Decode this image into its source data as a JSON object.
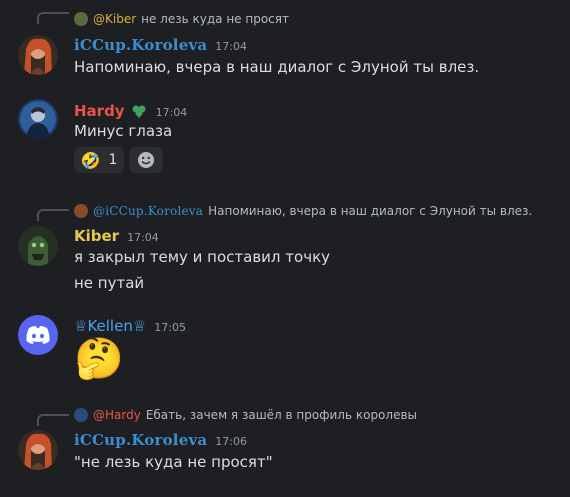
{
  "messages": [
    {
      "reply": {
        "author": "@Kiber",
        "text": "не лезь куда не просят",
        "author_color": "#d4b13a"
      },
      "author": "iCCup.Koroleva",
      "author_color": "#3b8fd0",
      "time": "17:04",
      "lines": [
        "Напоминаю, вчера в наш диалог с Элуной ты влез."
      ]
    },
    {
      "author": "Hardy",
      "author_color": "#e8544b",
      "badge": "clover-icon",
      "time": "17:04",
      "lines": [
        "Минус глаза"
      ],
      "reaction": {
        "emoji": "🤣",
        "count": "1"
      }
    },
    {
      "reply": {
        "author": "@iCCup.Koroleva",
        "text": "Напоминаю, вчера в наш диалог с Элуной ты влез.",
        "author_color": "#3b8fd0"
      },
      "author": "Kiber",
      "author_color": "#e8c84a",
      "time": "17:04",
      "lines": [
        "я закрыл тему и поставил точку",
        "не путай"
      ]
    },
    {
      "author": "♕Kellen♕",
      "author_color": "#4aa3e8",
      "time": "17:05",
      "lines": [],
      "emoji": "🤔"
    },
    {
      "reply": {
        "author": "@Hardy",
        "text": "Ебать, зачем я зашёл в профиль королевы",
        "author_color": "#e8544b"
      },
      "author": "iCCup.Koroleva",
      "author_color": "#3b8fd0",
      "time": "17:06",
      "lines": [
        "\"не лезь куда не просят\""
      ]
    }
  ]
}
